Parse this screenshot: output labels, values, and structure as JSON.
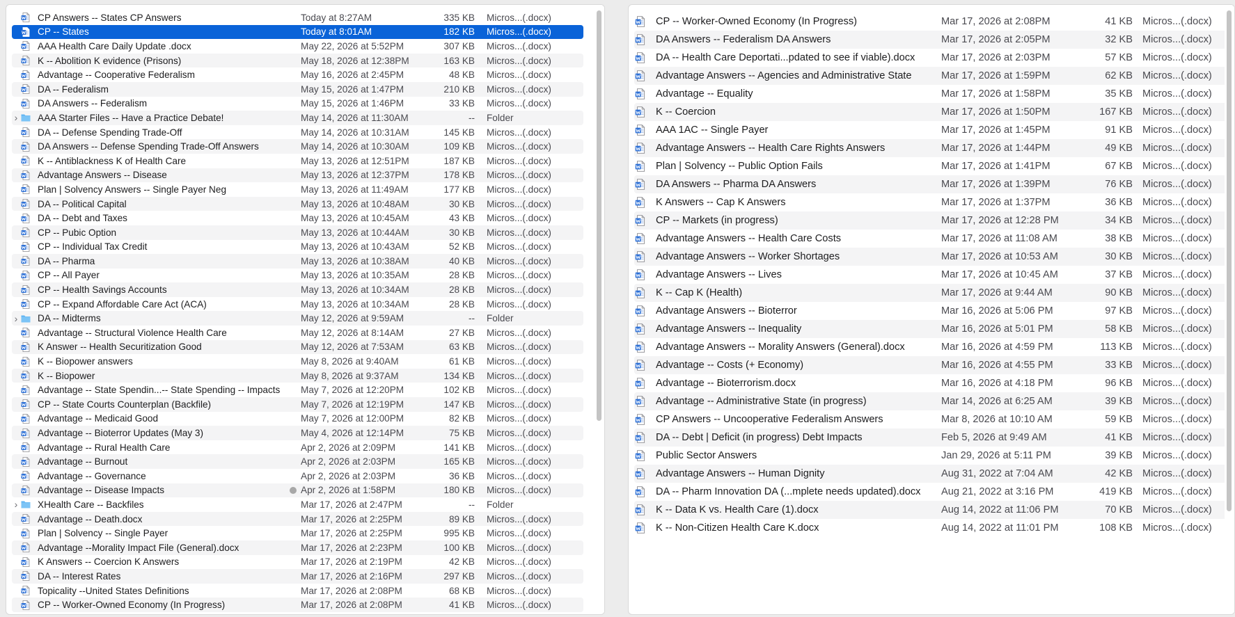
{
  "colors": {
    "selection": "#0a63d8",
    "folder": "#5fb4f2",
    "doc_icon": "#2b6fd6"
  },
  "left_pane": {
    "rows": [
      {
        "name": "CP Answers -- States CP Answers",
        "date": "Today at 8:27AM",
        "size": "335 KB",
        "kind": "Micros...(.docx)",
        "type": "doc"
      },
      {
        "name": "CP -- States",
        "date": "Today at 8:01AM",
        "size": "182 KB",
        "kind": "Micros...(.docx)",
        "type": "doc",
        "selected": true
      },
      {
        "name": "AAA  Health Care Daily Update .docx",
        "date": "May 22, 2026 at 5:52PM",
        "size": "307 KB",
        "kind": "Micros...(.docx)",
        "type": "doc"
      },
      {
        "name": "K -- Abolition K evidence (Prisons)",
        "date": "May 18, 2026 at 12:38PM",
        "size": "163 KB",
        "kind": "Micros...(.docx)",
        "type": "doc"
      },
      {
        "name": "Advantage -- Cooperative Federalism",
        "date": "May 16, 2026 at 2:45PM",
        "size": "48 KB",
        "kind": "Micros...(.docx)",
        "type": "doc"
      },
      {
        "name": "DA -- Federalism",
        "date": "May 15, 2026 at 1:47PM",
        "size": "210 KB",
        "kind": "Micros...(.docx)",
        "type": "doc"
      },
      {
        "name": "DA Answers -- Federalism",
        "date": "May 15, 2026 at 1:46PM",
        "size": "33 KB",
        "kind": "Micros...(.docx)",
        "type": "doc"
      },
      {
        "name": "AAA Starter Files -- Have a Practice Debate!",
        "date": "May 14, 2026 at 11:30AM",
        "size": "--",
        "kind": "Folder",
        "type": "folder"
      },
      {
        "name": "DA -- Defense Spending Trade-Off",
        "date": "May 14, 2026 at 10:31AM",
        "size": "145 KB",
        "kind": "Micros...(.docx)",
        "type": "doc"
      },
      {
        "name": "DA Answers -- Defense Spending Trade-Off Answers",
        "date": "May 14, 2026 at 10:30AM",
        "size": "109 KB",
        "kind": "Micros...(.docx)",
        "type": "doc"
      },
      {
        "name": "K -- Antiblackness K of Health Care",
        "date": "May 13, 2026 at 12:51PM",
        "size": "187 KB",
        "kind": "Micros...(.docx)",
        "type": "doc"
      },
      {
        "name": "Advantage Answers -- Disease",
        "date": "May 13, 2026 at 12:37PM",
        "size": "178 KB",
        "kind": "Micros...(.docx)",
        "type": "doc"
      },
      {
        "name": "Plan | Solvency Answers -- Single Payer Neg",
        "date": "May 13, 2026 at 11:49AM",
        "size": "177 KB",
        "kind": "Micros...(.docx)",
        "type": "doc"
      },
      {
        "name": "DA -- Political Capital",
        "date": "May 13, 2026 at 10:48AM",
        "size": "30 KB",
        "kind": "Micros...(.docx)",
        "type": "doc"
      },
      {
        "name": "DA -- Debt and Taxes",
        "date": "May 13, 2026 at 10:45AM",
        "size": "43 KB",
        "kind": "Micros...(.docx)",
        "type": "doc"
      },
      {
        "name": "CP -- Pubic Option",
        "date": "May 13, 2026 at 10:44AM",
        "size": "30 KB",
        "kind": "Micros...(.docx)",
        "type": "doc"
      },
      {
        "name": "CP -- Individual Tax Credit",
        "date": "May 13, 2026 at 10:43AM",
        "size": "52 KB",
        "kind": "Micros...(.docx)",
        "type": "doc"
      },
      {
        "name": "DA -- Pharma",
        "date": "May 13, 2026 at 10:38AM",
        "size": "40 KB",
        "kind": "Micros...(.docx)",
        "type": "doc"
      },
      {
        "name": "CP -- All Payer",
        "date": "May 13, 2026 at 10:35AM",
        "size": "28 KB",
        "kind": "Micros...(.docx)",
        "type": "doc"
      },
      {
        "name": "CP -- Health Savings Accounts",
        "date": "May 13, 2026 at 10:34AM",
        "size": "28 KB",
        "kind": "Micros...(.docx)",
        "type": "doc"
      },
      {
        "name": "CP -- Expand Affordable Care Act (ACA)",
        "date": "May 13, 2026 at 10:34AM",
        "size": "28 KB",
        "kind": "Micros...(.docx)",
        "type": "doc"
      },
      {
        "name": "DA -- Midterms",
        "date": "May 12, 2026 at 9:59AM",
        "size": "--",
        "kind": "Folder",
        "type": "folder"
      },
      {
        "name": "Advantage -- Structural Violence Health Care",
        "date": "May 12, 2026 at 8:14AM",
        "size": "27 KB",
        "kind": "Micros...(.docx)",
        "type": "doc"
      },
      {
        "name": "K Answer -- Health Securitization Good",
        "date": "May 12, 2026 at 7:53AM",
        "size": "63 KB",
        "kind": "Micros...(.docx)",
        "type": "doc"
      },
      {
        "name": "K -- Biopower answers",
        "date": "May 8, 2026 at 9:40AM",
        "size": "61 KB",
        "kind": "Micros...(.docx)",
        "type": "doc"
      },
      {
        "name": "K -- Biopower",
        "date": "May 8, 2026 at 9:37AM",
        "size": "134 KB",
        "kind": "Micros...(.docx)",
        "type": "doc"
      },
      {
        "name": "Advantage -- State Spendin...-- State Spending -- Impacts",
        "date": "May 7, 2026 at 12:20PM",
        "size": "102 KB",
        "kind": "Micros...(.docx)",
        "type": "doc"
      },
      {
        "name": "CP -- State Courts Counterplan (Backfile)",
        "date": "May 7, 2026 at 12:19PM",
        "size": "147 KB",
        "kind": "Micros...(.docx)",
        "type": "doc"
      },
      {
        "name": "Advantage -- Medicaid Good",
        "date": "May 7, 2026 at 12:00PM",
        "size": "82 KB",
        "kind": "Micros...(.docx)",
        "type": "doc"
      },
      {
        "name": "Advantage -- Bioterror Updates (May 3)",
        "date": "May 4, 2026 at 12:14PM",
        "size": "75 KB",
        "kind": "Micros...(.docx)",
        "type": "doc"
      },
      {
        "name": "Advantage -- Rural Health Care",
        "date": "Apr 2, 2026 at 2:09PM",
        "size": "141 KB",
        "kind": "Micros...(.docx)",
        "type": "doc"
      },
      {
        "name": "Advantage -- Burnout",
        "date": "Apr 2, 2026 at 2:03PM",
        "size": "165 KB",
        "kind": "Micros...(.docx)",
        "type": "doc"
      },
      {
        "name": "Advantage -- Governance",
        "date": "Apr 2, 2026 at 2:03PM",
        "size": "36 KB",
        "kind": "Micros...(.docx)",
        "type": "doc"
      },
      {
        "name": "Advantage -- Disease Impacts",
        "date": "Apr 2, 2026 at 1:58PM",
        "size": "180 KB",
        "kind": "Micros...(.docx)",
        "type": "doc",
        "tag": true
      },
      {
        "name": "XHealth Care -- Backfiles",
        "date": "Mar 17, 2026 at 2:47PM",
        "size": "--",
        "kind": "Folder",
        "type": "folder"
      },
      {
        "name": "Advantage -- Death.docx",
        "date": "Mar 17, 2026 at 2:25PM",
        "size": "89 KB",
        "kind": "Micros...(.docx)",
        "type": "doc"
      },
      {
        "name": "Plan | Solvency -- Single Payer",
        "date": "Mar 17, 2026 at 2:25PM",
        "size": "995 KB",
        "kind": "Micros...(.docx)",
        "type": "doc"
      },
      {
        "name": "Advantage --Morality Impact File (General).docx",
        "date": "Mar 17, 2026 at 2:23PM",
        "size": "100 KB",
        "kind": "Micros...(.docx)",
        "type": "doc"
      },
      {
        "name": "K Answers -- Coercion K Answers",
        "date": "Mar 17, 2026 at 2:19PM",
        "size": "42 KB",
        "kind": "Micros...(.docx)",
        "type": "doc"
      },
      {
        "name": "DA -- Interest Rates",
        "date": "Mar 17, 2026 at 2:16PM",
        "size": "297 KB",
        "kind": "Micros...(.docx)",
        "type": "doc"
      },
      {
        "name": "Topicality --United States Definitions",
        "date": "Mar 17, 2026 at 2:08PM",
        "size": "68 KB",
        "kind": "Micros...(.docx)",
        "type": "doc"
      },
      {
        "name": "CP -- Worker-Owned Economy (In Progress)",
        "date": "Mar 17, 2026 at 2:08PM",
        "size": "41 KB",
        "kind": "Micros...(.docx)",
        "type": "doc"
      }
    ]
  },
  "right_pane": {
    "rows": [
      {
        "name": "CP -- Worker-Owned Economy (In Progress)",
        "date": "Mar 17, 2026 at 2:08PM",
        "size": "41 KB",
        "kind": "Micros...(.docx)",
        "type": "doc"
      },
      {
        "name": "DA Answers -- Federalism DA Answers",
        "date": "Mar 17, 2026 at 2:05PM",
        "size": "32 KB",
        "kind": "Micros...(.docx)",
        "type": "doc"
      },
      {
        "name": "DA -- Health Care Deportati...pdated to see if viable).docx",
        "date": "Mar 17, 2026 at 2:03PM",
        "size": "57 KB",
        "kind": "Micros...(.docx)",
        "type": "doc"
      },
      {
        "name": "Advantage Answers -- Agencies and Administrative State",
        "date": "Mar 17, 2026 at 1:59PM",
        "size": "62 KB",
        "kind": "Micros...(.docx)",
        "type": "doc"
      },
      {
        "name": "Advantage -- Equality",
        "date": "Mar 17, 2026 at 1:58PM",
        "size": "35 KB",
        "kind": "Micros...(.docx)",
        "type": "doc"
      },
      {
        "name": "K -- Coercion",
        "date": "Mar 17, 2026 at 1:50PM",
        "size": "167 KB",
        "kind": "Micros...(.docx)",
        "type": "doc"
      },
      {
        "name": "AAA 1AC -- Single Payer",
        "date": "Mar 17, 2026 at 1:45PM",
        "size": "91 KB",
        "kind": "Micros...(.docx)",
        "type": "doc"
      },
      {
        "name": "Advantage Answers -- Health Care Rights Answers",
        "date": "Mar 17, 2026 at 1:44PM",
        "size": "49 KB",
        "kind": "Micros...(.docx)",
        "type": "doc"
      },
      {
        "name": "Plan | Solvency -- Public Option Fails",
        "date": "Mar 17, 2026 at 1:41PM",
        "size": "67 KB",
        "kind": "Micros...(.docx)",
        "type": "doc"
      },
      {
        "name": "DA Answers -- Pharma DA Answers",
        "date": "Mar 17, 2026 at 1:39PM",
        "size": "76 KB",
        "kind": "Micros...(.docx)",
        "type": "doc"
      },
      {
        "name": "K Answers -- Cap K Answers",
        "date": "Mar 17, 2026 at 1:37PM",
        "size": "36 KB",
        "kind": "Micros...(.docx)",
        "type": "doc"
      },
      {
        "name": "CP -- Markets (in progress)",
        "date": "Mar 17, 2026 at 12:28 PM",
        "size": "34 KB",
        "kind": "Micros...(.docx)",
        "type": "doc"
      },
      {
        "name": "Advantage Answers --  Health Care Costs",
        "date": "Mar 17, 2026 at 11:08 AM",
        "size": "38 KB",
        "kind": "Micros...(.docx)",
        "type": "doc"
      },
      {
        "name": "Advantage Answers -- Worker Shortages",
        "date": "Mar 17, 2026 at 10:53 AM",
        "size": "30 KB",
        "kind": "Micros...(.docx)",
        "type": "doc"
      },
      {
        "name": "Advantage Answers -- Lives",
        "date": "Mar 17, 2026 at 10:45 AM",
        "size": "37 KB",
        "kind": "Micros...(.docx)",
        "type": "doc"
      },
      {
        "name": "K -- Cap K (Health)",
        "date": "Mar 17, 2026 at 9:44 AM",
        "size": "90 KB",
        "kind": "Micros...(.docx)",
        "type": "doc"
      },
      {
        "name": "Advantage Answers -- Bioterror",
        "date": "Mar 16, 2026 at 5:06 PM",
        "size": "97 KB",
        "kind": "Micros...(.docx)",
        "type": "doc"
      },
      {
        "name": "Advantage Answers -- Inequality",
        "date": "Mar 16, 2026 at 5:01 PM",
        "size": "58 KB",
        "kind": "Micros...(.docx)",
        "type": "doc"
      },
      {
        "name": "Advantage Answers -- Morality Answers (General).docx",
        "date": "Mar 16, 2026 at 4:59 PM",
        "size": "113 KB",
        "kind": "Micros...(.docx)",
        "type": "doc"
      },
      {
        "name": "Advantage -- Costs (+ Economy)",
        "date": "Mar 16, 2026 at 4:55 PM",
        "size": "33 KB",
        "kind": "Micros...(.docx)",
        "type": "doc"
      },
      {
        "name": "Advantage -- Bioterrorism.docx",
        "date": "Mar 16, 2026 at 4:18 PM",
        "size": "96 KB",
        "kind": "Micros...(.docx)",
        "type": "doc"
      },
      {
        "name": "Advantage -- Administrative State (in progress)",
        "date": "Mar 14, 2026 at 6:25 AM",
        "size": "39 KB",
        "kind": "Micros...(.docx)",
        "type": "doc"
      },
      {
        "name": "CP Answers -- Uncooperative Federalism Answers",
        "date": "Mar 8, 2026 at 10:10 AM",
        "size": "59 KB",
        "kind": "Micros...(.docx)",
        "type": "doc"
      },
      {
        "name": "DA -- Debt | Deficit (in progress) Debt Impacts",
        "date": "Feb 5, 2026 at 9:49 AM",
        "size": "41 KB",
        "kind": "Micros...(.docx)",
        "type": "doc"
      },
      {
        "name": "Public Sector Answers",
        "date": "Jan 29, 2026 at 5:11 PM",
        "size": "39 KB",
        "kind": "Micros...(.docx)",
        "type": "doc"
      },
      {
        "name": "Advantage Answers --  Human Dignity",
        "date": "Aug 31, 2022 at 7:04 AM",
        "size": "42 KB",
        "kind": "Micros...(.docx)",
        "type": "doc"
      },
      {
        "name": "DA -- Pharm Innovation DA (...mplete needs updated).docx",
        "date": "Aug 21, 2022 at 3:16 PM",
        "size": "419 KB",
        "kind": "Micros...(.docx)",
        "type": "doc"
      },
      {
        "name": "K -- Data K vs. Health Care (1).docx",
        "date": "Aug 14, 2022 at 11:06 PM",
        "size": "70 KB",
        "kind": "Micros...(.docx)",
        "type": "doc"
      },
      {
        "name": "K -- Non-Citizen Health Care K.docx",
        "date": "Aug 14, 2022 at 11:01 PM",
        "size": "108 KB",
        "kind": "Micros...(.docx)",
        "type": "doc"
      }
    ]
  }
}
